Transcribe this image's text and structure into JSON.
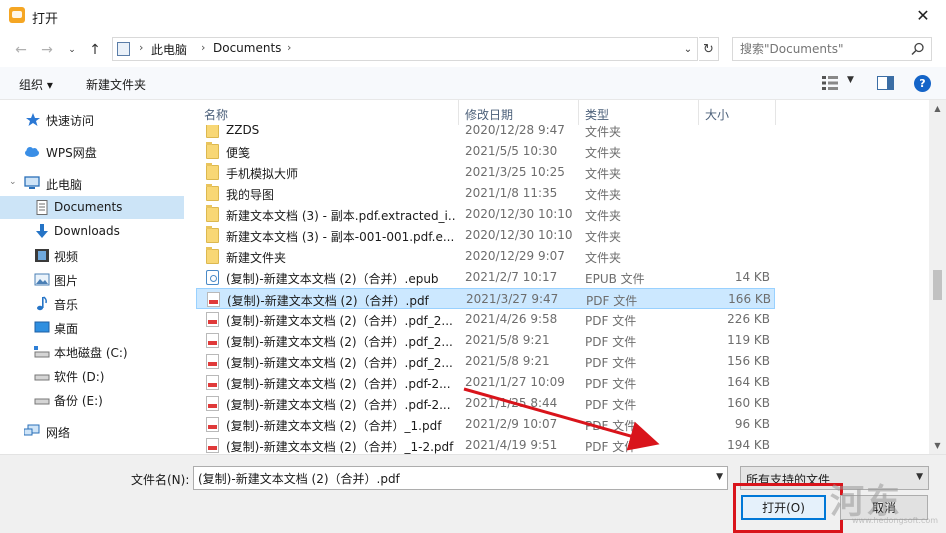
{
  "window": {
    "title": "打开",
    "close_glyph": "✕"
  },
  "address": {
    "crumbs": [
      "此电脑",
      "Documents"
    ],
    "separator": "›",
    "search_placeholder": "搜索\"Documents\""
  },
  "toolbar": {
    "organize_label": "组织 ▾",
    "new_folder_label": "新建文件夹"
  },
  "nav": {
    "items": [
      {
        "label": "快速访问",
        "icon": "star-icon"
      },
      {
        "label": "WPS网盘",
        "icon": "cloud-icon"
      },
      {
        "label": "此电脑",
        "icon": "computer-icon"
      },
      {
        "label": "Documents",
        "icon": "documents-icon"
      },
      {
        "label": "Downloads",
        "icon": "download-icon"
      },
      {
        "label": "视频",
        "icon": "video-icon"
      },
      {
        "label": "图片",
        "icon": "picture-icon"
      },
      {
        "label": "音乐",
        "icon": "music-icon"
      },
      {
        "label": "桌面",
        "icon": "desktop-icon"
      },
      {
        "label": "本地磁盘 (C:)",
        "icon": "drive-icon"
      },
      {
        "label": "软件 (D:)",
        "icon": "drive-icon"
      },
      {
        "label": "备份 (E:)",
        "icon": "drive-icon"
      },
      {
        "label": "网络",
        "icon": "network-icon"
      }
    ]
  },
  "columns": {
    "name": "名称",
    "date": "修改日期",
    "type": "类型",
    "size": "大小"
  },
  "files": [
    {
      "name": "ZZDS",
      "date": "2020/12/28 9:47",
      "type": "文件夹",
      "size": "",
      "kind": "folder"
    },
    {
      "name": "便笺",
      "date": "2021/5/5 10:30",
      "type": "文件夹",
      "size": "",
      "kind": "folder"
    },
    {
      "name": "手机模拟大师",
      "date": "2021/3/25 10:25",
      "type": "文件夹",
      "size": "",
      "kind": "folder"
    },
    {
      "name": "我的导图",
      "date": "2021/1/8 11:35",
      "type": "文件夹",
      "size": "",
      "kind": "folder"
    },
    {
      "name": "新建文本文档 (3) - 副本.pdf.extracted_i...",
      "date": "2020/12/30 10:10",
      "type": "文件夹",
      "size": "",
      "kind": "folder"
    },
    {
      "name": "新建文本文档 (3) - 副本-001-001.pdf.e...",
      "date": "2020/12/30 10:10",
      "type": "文件夹",
      "size": "",
      "kind": "folder"
    },
    {
      "name": "新建文件夹",
      "date": "2020/12/29 9:07",
      "type": "文件夹",
      "size": "",
      "kind": "folder"
    },
    {
      "name": "(复制)-新建文本文档 (2)（合并）.epub",
      "date": "2021/2/7 10:17",
      "type": "EPUB 文件",
      "size": "14 KB",
      "kind": "epub"
    },
    {
      "name": "(复制)-新建文本文档 (2)（合并）.pdf",
      "date": "2021/3/27 9:47",
      "type": "PDF 文件",
      "size": "166 KB",
      "kind": "pdf",
      "selected": true
    },
    {
      "name": "(复制)-新建文本文档 (2)（合并）.pdf_2...",
      "date": "2021/4/26 9:58",
      "type": "PDF 文件",
      "size": "226 KB",
      "kind": "pdf"
    },
    {
      "name": "(复制)-新建文本文档 (2)（合并）.pdf_2...",
      "date": "2021/5/8 9:21",
      "type": "PDF 文件",
      "size": "119 KB",
      "kind": "pdf"
    },
    {
      "name": "(复制)-新建文本文档 (2)（合并）.pdf_2...",
      "date": "2021/5/8 9:21",
      "type": "PDF 文件",
      "size": "156 KB",
      "kind": "pdf"
    },
    {
      "name": "(复制)-新建文本文档 (2)（合并）.pdf-2...",
      "date": "2021/1/27 10:09",
      "type": "PDF 文件",
      "size": "164 KB",
      "kind": "pdf"
    },
    {
      "name": "(复制)-新建文本文档 (2)（合并）.pdf-2...",
      "date": "2021/1/25 8:44",
      "type": "PDF 文件",
      "size": "160 KB",
      "kind": "pdf"
    },
    {
      "name": "(复制)-新建文本文档 (2)（合并）_1.pdf",
      "date": "2021/2/9 10:07",
      "type": "PDF 文件",
      "size": "96 KB",
      "kind": "pdf"
    },
    {
      "name": "(复制)-新建文本文档 (2)（合并）_1-2.pdf",
      "date": "2021/4/19 9:51",
      "type": "PDF 文件",
      "size": "194 KB",
      "kind": "pdf"
    }
  ],
  "bottom": {
    "filename_label": "文件名(N):",
    "filename_value": "(复制)-新建文本文档 (2)（合并）.pdf",
    "filetype_value": "所有支持的文件",
    "open_label": "打开(O)",
    "cancel_label": "取消"
  },
  "watermark": {
    "text": "河东",
    "url": "www.hedongsoft.com"
  },
  "colors": {
    "selection": "#cce8ff",
    "highlight_outline": "#d9141b",
    "arrow": "#d9141b"
  }
}
